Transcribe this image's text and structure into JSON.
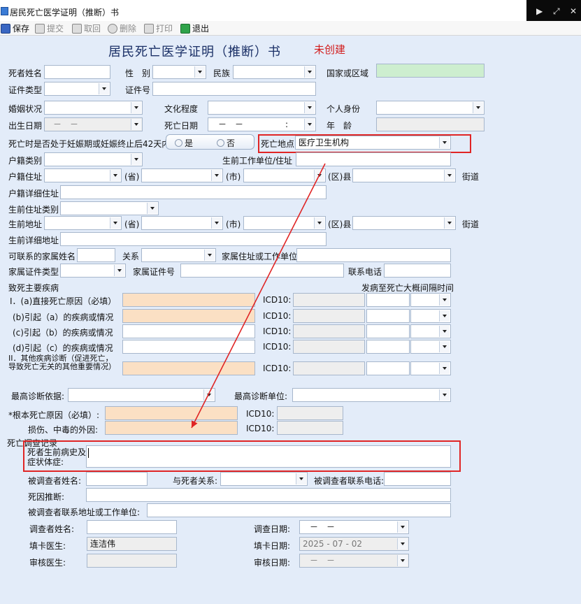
{
  "window": {
    "title": "居民死亡医学证明（推断）书",
    "corner_text": "831 × 864",
    "controls": [
      "▶",
      "⤢",
      "✕"
    ]
  },
  "toolbar": {
    "save": "保存",
    "submit": "提交",
    "withdraw": "取回",
    "delete": "删除",
    "print": "打印",
    "exit": "退出"
  },
  "form": {
    "title": "居民死亡医学证明（推断）书",
    "status": "未创建"
  },
  "labels": {
    "name": "死者姓名",
    "gender": "性　别",
    "ethnicity": "民族",
    "country": "国家或区域",
    "id_type": "证件类型",
    "id_no": "证件号",
    "marital": "婚姻状况",
    "education": "文化程度",
    "personal_identity": "个人身份",
    "birth_date": "出生日期",
    "death_date": "死亡日期",
    "age": "年　龄",
    "pregnancy": "死亡时是否处于妊娠期或妊娠终止后42天内",
    "yes": "是",
    "no": "否",
    "death_place": "死亡地点",
    "household_type": "户籍类别",
    "workplace": "生前工作单位/住址",
    "household_addr": "户籍住址",
    "prov": "(省)",
    "city": "(市)",
    "county": "(区)县",
    "street": "街道",
    "household_detail": "户籍详细住址",
    "residence_type": "生前住址类别",
    "residence_addr": "生前地址",
    "residence_detail": "生前详细地址",
    "family_name": "可联系的家属姓名",
    "relation": "关系",
    "family_addr": "家属住址或工作单位",
    "family_id_type": "家属证件类型",
    "family_id_no": "家属证件号",
    "phone": "联系电话",
    "main_disease": "致死主要疾病",
    "interval": "发病至死亡大概间隔时间",
    "cause_a": "I．(a)直接死亡原因（必填）",
    "cause_b": "(b)引起（a）的疾病或情况",
    "cause_c": "(c)引起（b）的疾病或情况",
    "cause_d": "(d)引起（c）的疾病或情况",
    "other_disease": "II．其他疾病诊断（促进死亡，导致死亡无关的其他重要情况）",
    "icd10": "ICD10:",
    "highest_basis": "最高诊断依据:",
    "highest_unit": "最高诊断单位:",
    "root_cause": "*根本死亡原因（必填）:",
    "injury_cause": "损伤、中毒的外因:",
    "survey_title": "死亡调查记录",
    "history": "死者生前病史及症状体症:",
    "respondent_name": "被调查者姓名:",
    "relation_deceased": "与死者关系:",
    "respondent_phone": "被调查者联系电话:",
    "cause_inference": "死因推断:",
    "respondent_addr": "被调查者联系地址或工作单位:",
    "investigator": "调查者姓名:",
    "survey_date": "调查日期:",
    "reporter": "填卡医生:",
    "report_date": "填卡日期:",
    "auditor": "审核医生:",
    "audit_date": "审核日期:"
  },
  "values": {
    "birth_date": "－　－",
    "death_date": "－　－　　　　　:",
    "death_place": "医疗卫生机构",
    "survey_date": "－　－",
    "reporter": "连洁伟",
    "report_date": "2025 - 07 - 02",
    "audit_date": "－　－"
  },
  "colors": {
    "highlight": "#e02525",
    "status": "#d21d1d"
  }
}
